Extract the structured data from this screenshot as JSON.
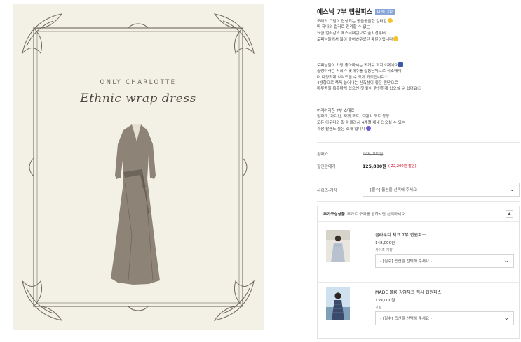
{
  "hero": {
    "brand": "ONLY CHARLOTTE",
    "script_title": "Ethnic wrap dress"
  },
  "product": {
    "title": "에스닉 7부 랩원피스",
    "badge": "LIMITED",
    "desc1": [
      "모레의 그림이 연상되는 동글동글한 컬러감",
      "딱 하나의 컬러로 정리할 수 없는",
      "묘한 컬러감의 에스닉패턴으로 출시전부터",
      "로피님들께서 많이 물어봐주셨던 패턴이랍니다"
    ],
    "desc2": [
      "로피님들이 가장 좋아하시는 핏개수 저지소재예요",
      "출렁이라는 저희가 핏개수를 살롱단독으로 직조해서",
      "더 다양하게 보여드릴 수 있게 되었답니다",
      "4방향으로 쭉쭉 늘어나는 신축성이 좋은 원단으로",
      "하루종일 촉촉하게 입으신 것 같이 편안하게 입으실 수 있어요"
    ],
    "desc3": [
      "여리여리한 7부 소매로",
      "청자켓, 가디건, 자켓,코트, 트렌치 코트 등등",
      "모든 아우터와 잘 어울려서 4계절 내내 입으실 수 있는",
      "가장 활용도 높은 소재 입니다"
    ]
  },
  "price": {
    "list_label": "판매가",
    "list_value": "148,000원",
    "sale_label": "할인판매가",
    "sale_value": "125,800원",
    "sale_note": "( 22,200원 할인)"
  },
  "option": {
    "label": "사이즈-기장",
    "placeholder": "- [필수] 옵션을 선택해 주세요 -"
  },
  "addon": {
    "head_bold": "추가구성상품",
    "head_text": "추가로 구매를 원하시면 선택하세요.",
    "collapse": "▲",
    "items": [
      {
        "name": "클라우디 체크 7부 랩원피스",
        "price": "148,000원",
        "opt_label": "사이즈-기장",
        "placeholder": "- [필수] 옵션을 선택해 주세요 -"
      },
      {
        "name": "MADE 볼륨 깅엄체크 맥시 랩원피스",
        "price": "139,000원",
        "opt_label": "기장",
        "placeholder": "- [필수] 옵션을 선택해 주세요 -"
      }
    ]
  },
  "icons": {
    "chevron": "chevron-down-icon",
    "emoji_face": "smile-emoji-icon",
    "heart": "heart-icon",
    "purple_emoji": "purple-emoji-icon",
    "blue_emoji": "blue-emoji-icon"
  },
  "colors": {
    "badge": "#8aa6d8",
    "discount": "#d0011b",
    "hero_bg": "#f3f0e6"
  }
}
